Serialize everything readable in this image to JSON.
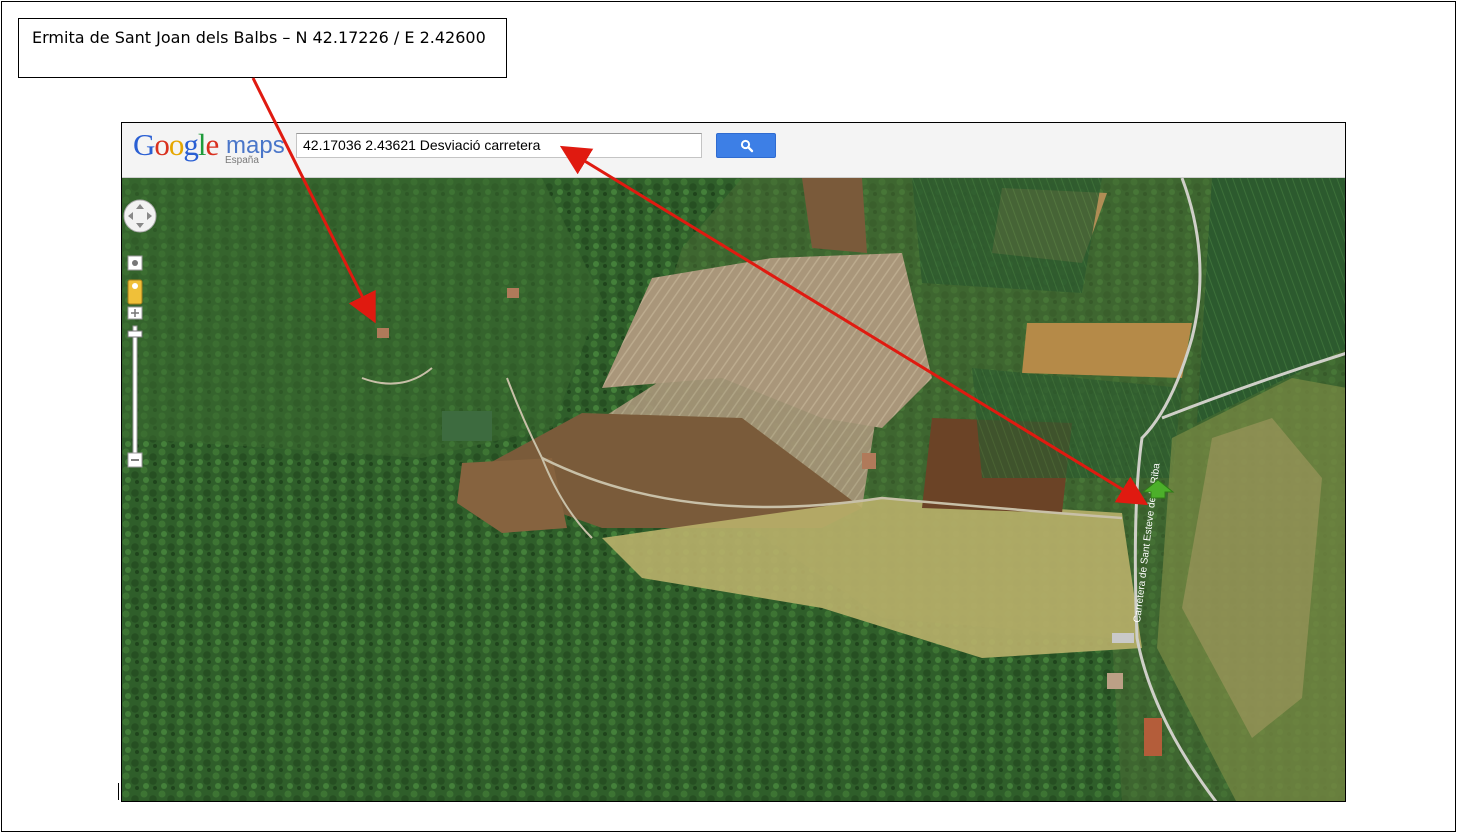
{
  "callout": {
    "text": "Ermita de Sant Joan dels Balbs – N 42.17226 / E 2.42600"
  },
  "maps": {
    "logo_letters": [
      "G",
      "o",
      "o",
      "g",
      "l",
      "e"
    ],
    "logo_suffix": "maps",
    "logo_region": "España",
    "search_value": "42.17036 2.43621  Desviació carretera",
    "search_button_icon": "search-icon"
  },
  "map": {
    "type": "satellite",
    "road_label": "Carretera de Sant Esteve de la Riba",
    "marker": "green-arrow-marker"
  },
  "colors": {
    "arrow": "#e01a10",
    "search_button": "#3d7fe6",
    "marker": "#4caf2a"
  }
}
